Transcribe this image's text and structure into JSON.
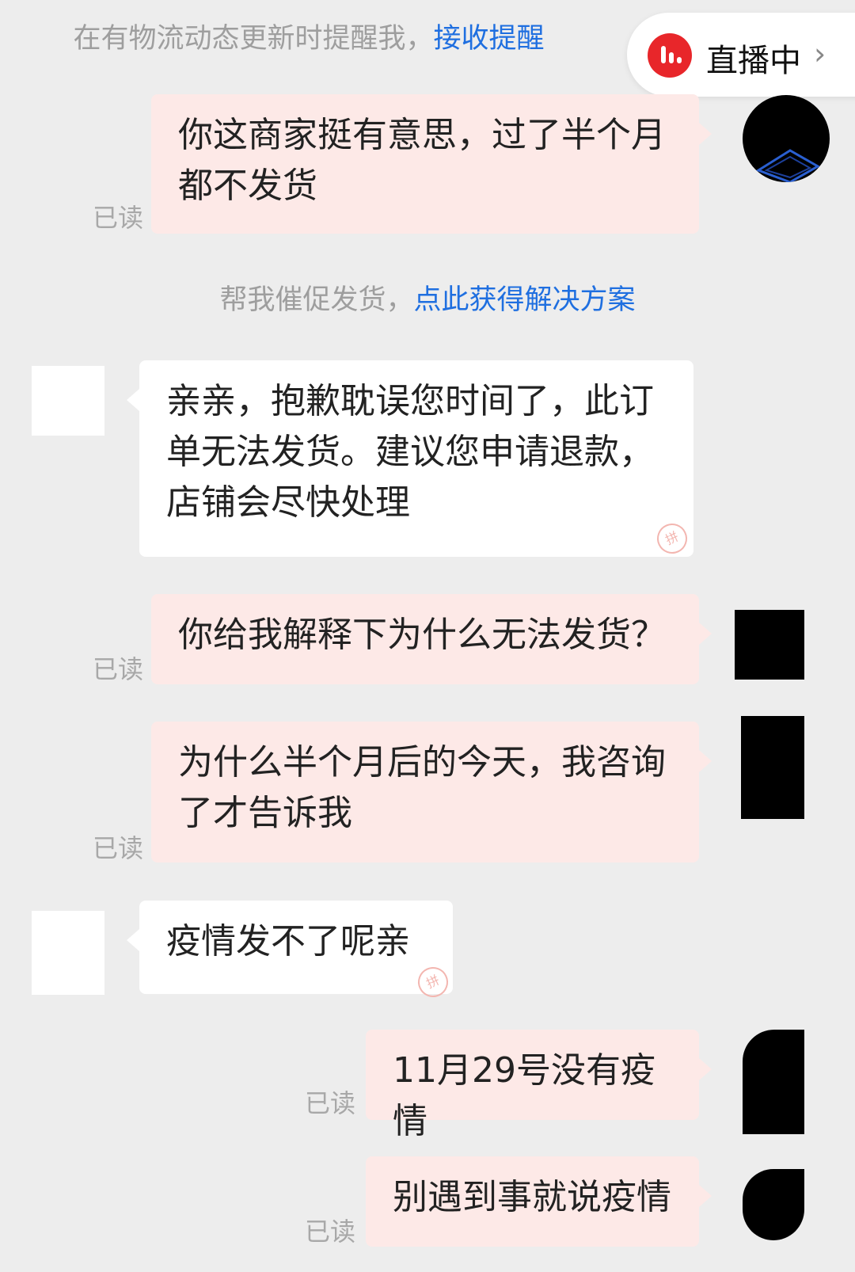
{
  "notices": {
    "logistics_prefix": "在有物流动态更新时提醒我，",
    "logistics_link": "接收提醒",
    "urge_prefix": "帮我催促发货，",
    "urge_link": "点此获得解决方案"
  },
  "live_badge": {
    "label": "直播中",
    "icon": "live-wave-icon",
    "accent": "#e8262a"
  },
  "read_label": "已读",
  "messages": [
    {
      "text": "你这商家挺有意思，过了半个月都不发货"
    },
    {
      "text": "亲亲，抱歉耽误您时间了，此订单无法发货。建议您申请退款，店铺会尽快处理"
    },
    {
      "text": "你给我解释下为什么无法发货？"
    },
    {
      "text": "为什么半个月后的今天，我咨询了才告诉我"
    },
    {
      "text": "疫情发不了呢亲"
    },
    {
      "text": "11月29号没有疫情"
    },
    {
      "text": "别遇到事就说疫情"
    }
  ]
}
